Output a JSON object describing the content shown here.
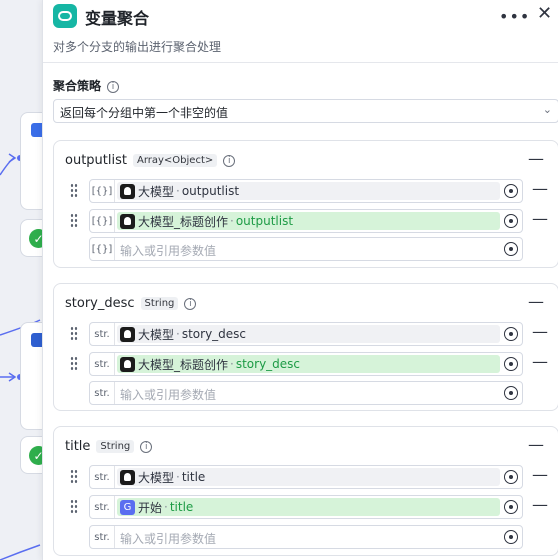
{
  "panel": {
    "title": "变量聚合",
    "subtitle": "对多个分支的输出进行聚合处理",
    "menu_icon": "more-horizontal-icon",
    "close_icon": "close-icon",
    "accent": "#16b6a4"
  },
  "strategy": {
    "label": "聚合策略",
    "value": "返回每个分组中第一个非空的值"
  },
  "groups": [
    {
      "name": "outputlist",
      "type": "Array<Object>",
      "type_glyph": "[{}]",
      "rows": [
        {
          "source": "大模型",
          "var": "outputlist",
          "highlight": false
        },
        {
          "source": "大模型_标题创作",
          "var": "outputlist",
          "highlight": true
        }
      ],
      "placeholder": "输入或引用参数值"
    },
    {
      "name": "story_desc",
      "type": "String",
      "type_glyph": "str.",
      "rows": [
        {
          "source": "大模型",
          "var": "story_desc",
          "highlight": false
        },
        {
          "source": "大模型_标题创作",
          "var": "story_desc",
          "highlight": true
        }
      ],
      "placeholder": "输入或引用参数值"
    },
    {
      "name": "title",
      "type": "String",
      "type_glyph": "str.",
      "rows": [
        {
          "source": "大模型",
          "var": "title",
          "highlight": false
        },
        {
          "source": "开始",
          "var": "title",
          "highlight": true
        }
      ],
      "placeholder": "输入或引用参数值"
    }
  ],
  "colors": {
    "highlight_bg": "#d6f3d9",
    "highlight_text": "#1d9b45",
    "start_node": "#5a6ef0"
  }
}
